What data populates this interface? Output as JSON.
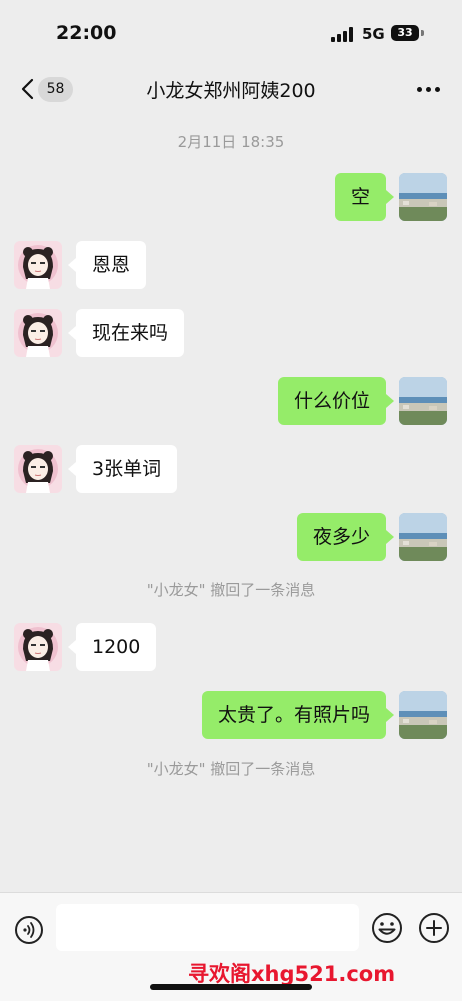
{
  "status_bar": {
    "time": "22:00",
    "network": "5G",
    "battery": "33"
  },
  "nav": {
    "unread_count": "58",
    "title": "小龙女郑州阿姨200"
  },
  "chat": {
    "timestamp": "2月11日 18:35",
    "messages": [
      {
        "side": "out",
        "text": "空"
      },
      {
        "side": "in",
        "text": "恩恩"
      },
      {
        "side": "in",
        "text": "现在来吗"
      },
      {
        "side": "out",
        "text": "什么价位"
      },
      {
        "side": "in",
        "text": "3张单词"
      },
      {
        "side": "out",
        "text": "夜多少"
      },
      {
        "side": "in",
        "text": "1200"
      },
      {
        "side": "out",
        "text": "太贵了。有照片吗"
      }
    ],
    "recall_notice_1": "\"小龙女\" 撤回了一条消息",
    "recall_notice_2": "\"小龙女\" 撤回了一条消息"
  },
  "input_bar": {
    "value": "",
    "placeholder": ""
  },
  "watermark": "寻欢阁xhg521.com",
  "colors": {
    "background": "#ededed",
    "outgoing_bubble": "#95ec69",
    "incoming_bubble": "#ffffff",
    "watermark": "#e8172f"
  },
  "icons": [
    "back-chevron-icon",
    "more-dots-icon",
    "voice-icon",
    "emoji-icon",
    "plus-icon"
  ]
}
